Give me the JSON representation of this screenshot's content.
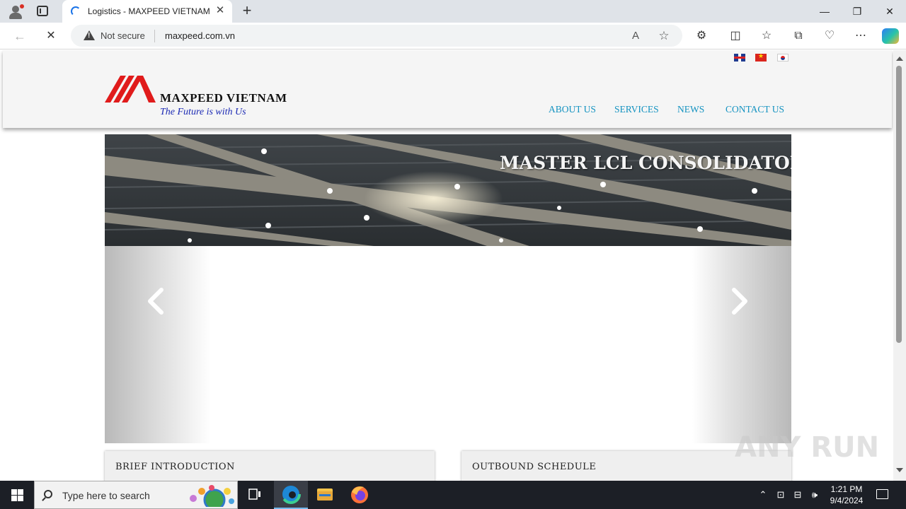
{
  "browser": {
    "tab_title": "Logistics - MAXPEED VIETNAM",
    "tab_close": "✕",
    "new_tab": "+",
    "security_label": "Not secure",
    "url": "maxpeed.com.vn",
    "window_controls": [
      "—",
      "❐",
      "✕"
    ],
    "icons": [
      "back-icon",
      "stop-loading-icon",
      "read-aloud-icon",
      "favorite-star-icon",
      "extensions-icon",
      "split-screen-icon",
      "favorites-icon",
      "collections-icon",
      "browser-essentials-icon",
      "more-menu-icon",
      "copilot-icon"
    ]
  },
  "site": {
    "languages": [
      "english-flag",
      "vietnam-flag",
      "korea-flag"
    ],
    "logo": {
      "name": "MAXPEED VIETNAM",
      "tagline": "The Future is with Us"
    },
    "nav": [
      "ABOUT US",
      "SERVICES",
      "NEWS",
      "CONTACT US"
    ],
    "slider": {
      "heading": "MASTER LCL CONSOLIDATOR"
    },
    "panels": [
      "BRIEF INTRODUCTION",
      "OUTBOUND SCHEDULE"
    ],
    "colors": {
      "nav": "#1593c1",
      "logo_red": "#e01b1b",
      "tagline": "#1c2ab4"
    }
  },
  "watermark": "ANY RUN",
  "taskbar": {
    "search_placeholder": "Type here to search",
    "apps": [
      "task-view-icon",
      "edge-icon",
      "file-explorer-icon",
      "firefox-icon"
    ],
    "time": "1:21 PM",
    "date": "9/4/2024"
  }
}
